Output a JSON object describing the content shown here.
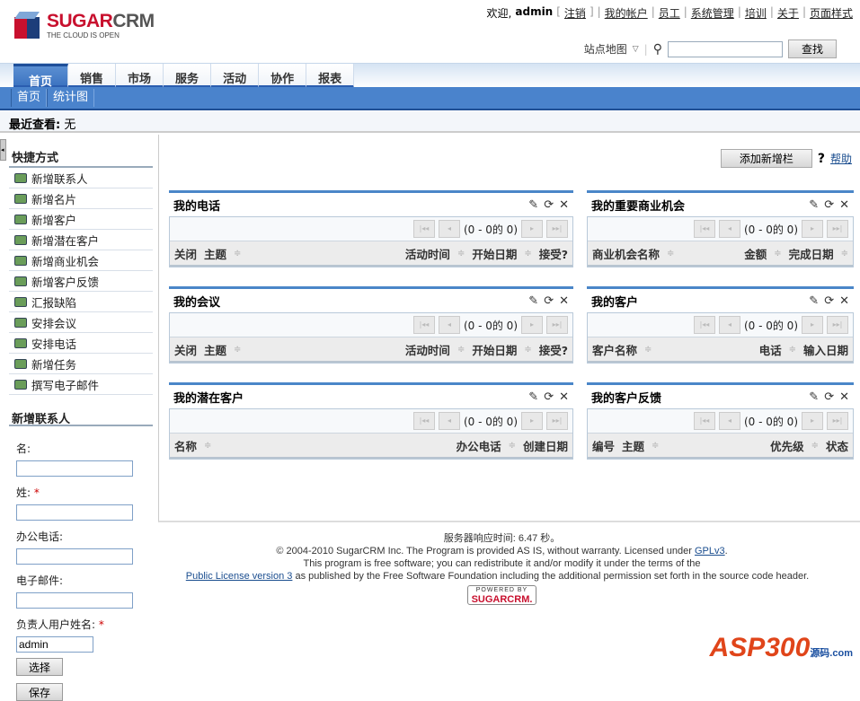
{
  "header": {
    "logo_main": "SUGAR",
    "logo_sub": "CRM",
    "logo_tagline": "THE CLOUD IS OPEN",
    "welcome": "欢迎,",
    "user": "admin",
    "logout": "注销",
    "links": [
      "我的帐户",
      "员工",
      "系统管理",
      "培训",
      "关于",
      "页面样式"
    ],
    "sitemap": "站点地图",
    "search_button": "查找",
    "search_value": ""
  },
  "tabs": [
    "首页",
    "销售",
    "市场",
    "服务",
    "活动",
    "协作",
    "报表"
  ],
  "subnav": [
    "首页",
    "统计图"
  ],
  "recent": {
    "label": "最近查看:",
    "value": "无"
  },
  "sidebar": {
    "shortcuts_title": "快捷方式",
    "shortcuts": [
      "新增联系人",
      "新增名片",
      "新增客户",
      "新增潜在客户",
      "新增商业机会",
      "新增客户反馈",
      "汇报缺陷",
      "安排会议",
      "安排电话",
      "新增任务",
      "撰写电子邮件"
    ],
    "form_title": "新增联系人",
    "fields": {
      "first": "名:",
      "last": "姓:",
      "phone": "办公电话:",
      "email": "电子邮件:",
      "owner": "负责人用户姓名:"
    },
    "owner_value": "admin",
    "select_button": "选择",
    "save_button": "保存"
  },
  "main": {
    "add_dashlet": "添加新增栏",
    "help": "帮助",
    "dashlets": [
      {
        "title": "我的电话",
        "paging": "(0 - 0的  0)",
        "cols_left": [
          "关闭",
          "主题"
        ],
        "cols_right": [
          "活动时间",
          "开始日期",
          "接受?"
        ]
      },
      {
        "title": "我的重要商业机会",
        "paging": "(0 - 0的  0)",
        "cols_left": [
          "商业机会名称"
        ],
        "cols_right": [
          "金额",
          "完成日期"
        ]
      },
      {
        "title": "我的会议",
        "paging": "(0 - 0的  0)",
        "cols_left": [
          "关闭",
          "主题"
        ],
        "cols_right": [
          "活动时间",
          "开始日期",
          "接受?"
        ]
      },
      {
        "title": "我的客户",
        "paging": "(0 - 0的  0)",
        "cols_left": [
          "客户名称"
        ],
        "cols_right": [
          "电话",
          "输入日期"
        ]
      },
      {
        "title": "我的潜在客户",
        "paging": "(0 - 0的  0)",
        "cols_left": [
          "名称"
        ],
        "cols_right": [
          "办公电话",
          "创建日期"
        ]
      },
      {
        "title": "我的客户反馈",
        "paging": "(0 - 0的  0)",
        "cols_left": [
          "编号",
          "主题"
        ],
        "cols_right": [
          "优先级",
          "状态"
        ]
      }
    ]
  },
  "footer": {
    "response": "服务器响应时间: 6.47 秒。",
    "copyright": "© 2004-2010 SugarCRM Inc. The Program is provided AS IS, without warranty. Licensed under ",
    "gpl": "GPLv3",
    "line2": "This program is free software; you can redistribute it and/or modify it under the terms of the",
    "license_link": "Public License version 3",
    "line3": " as published by the Free Software Foundation including the additional permission set forth in the source code header.",
    "powered_by": "POWERED BY",
    "powered_logo": "SUGARCRM."
  },
  "watermark": {
    "text": "ASP300",
    "sub": "源码.com"
  }
}
